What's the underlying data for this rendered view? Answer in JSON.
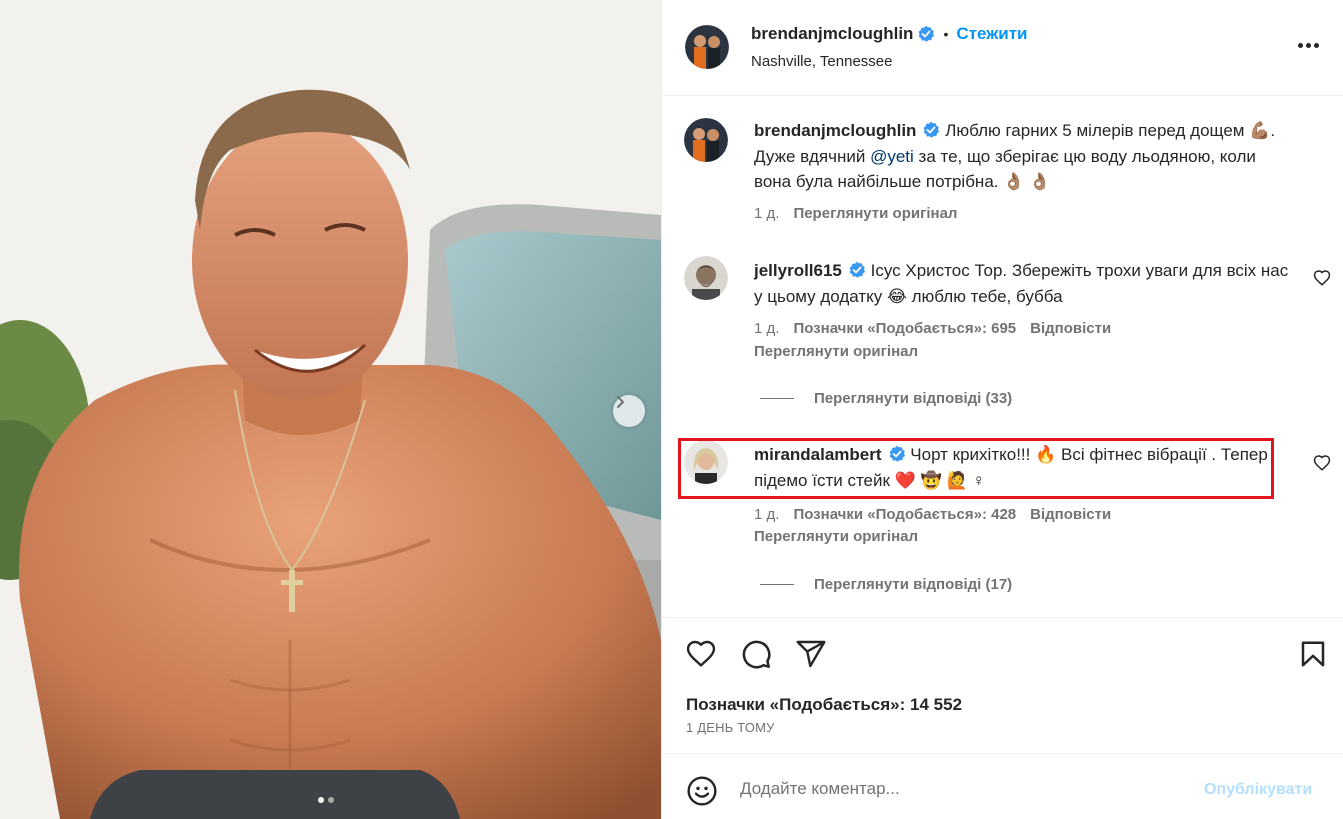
{
  "post": {
    "author": "brendanjmcloughlin",
    "follow_label": "Стежити",
    "separator": "•",
    "location": "Nashville, Tennessee",
    "carousel": {
      "slides": 2,
      "active": 1
    }
  },
  "caption": {
    "author": "brendanjmcloughlin",
    "text_a": "Люблю гарних 5 мілерів перед дощем",
    "emoji_a": "💪🏽",
    "text_b": ". Дуже вдячний",
    "mention": "@yeti",
    "text_c": "за те, що зберігає цю воду льодяною, коли вона була найбільше потрібна.",
    "emoji_b": "👌🏽 👌🏽",
    "time": "1 д.",
    "see_original": "Переглянути оригінал"
  },
  "comments": [
    {
      "author": "jellyroll615",
      "text_a": "Ісус Христос Тор. Збережіть трохи уваги для всіх нас у цьому додатку",
      "emoji_a": "😂",
      "text_b": "люблю тебе, бубба",
      "time": "1 д.",
      "likes": "Позначки «Подобається»: 695",
      "reply": "Відповісти",
      "see_original": "Переглянути оригінал",
      "view_replies": "Переглянути відповіді (33)"
    },
    {
      "author": "mirandalambert",
      "text_a": "Чорт крихітко!!!",
      "emoji_a": "🔥",
      "text_b": "Всі фітнес вібрації . Тепер підемо їсти стейк",
      "emoji_b": "❤️ 🤠 🙋 ♀",
      "time": "1 д.",
      "likes": "Позначки «Подобається»: 428",
      "reply": "Відповісти",
      "see_original": "Переглянути оригінал",
      "view_replies": "Переглянути відповіді (17)"
    }
  ],
  "footer": {
    "likes": "Позначки «Подобається»: 14 552",
    "ago": "1 ДЕНЬ ТОМУ",
    "comment_placeholder": "Додайте коментар...",
    "publish": "Опублікувати"
  },
  "colors": {
    "accent": "#0095f6",
    "highlight": "#e3141b",
    "muted": "#737373",
    "verified": "#3897f0"
  },
  "icons": [
    "heart-icon",
    "comment-icon",
    "share-icon",
    "bookmark-icon",
    "emoji-icon",
    "verified-icon",
    "more-icon",
    "chevron-right-icon"
  ]
}
